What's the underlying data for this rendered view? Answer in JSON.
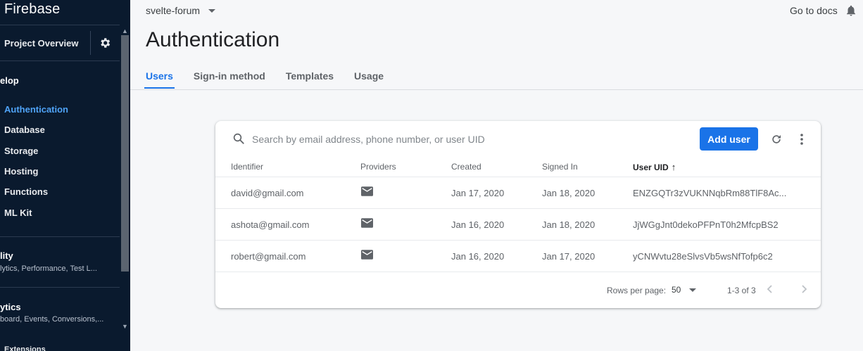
{
  "sidebar": {
    "brand": "Firebase",
    "overview": "Project Overview",
    "develop": {
      "title": "elop",
      "items": [
        "Authentication",
        "Database",
        "Storage",
        "Hosting",
        "Functions",
        "ML Kit"
      ]
    },
    "quality": {
      "title": "lity",
      "subtitle": "lytics, Performance, Test L..."
    },
    "analytics": {
      "title": "ytics",
      "subtitle": "board, Events, Conversions,..."
    },
    "extensions": "Extensions"
  },
  "header": {
    "project": "svelte-forum",
    "docs": "Go to docs",
    "title": "Authentication"
  },
  "tabs": [
    "Users",
    "Sign-in method",
    "Templates",
    "Usage"
  ],
  "table": {
    "search_placeholder": "Search by email address, phone number, or user UID",
    "add_user": "Add user",
    "columns": [
      "Identifier",
      "Providers",
      "Created",
      "Signed In",
      "User UID"
    ],
    "sort_arrow": "↑",
    "rows": [
      {
        "identifier": "david@gmail.com",
        "created": "Jan 17, 2020",
        "signed_in": "Jan 18, 2020",
        "uid": "ENZGQTr3zVUKNNqbRm88TlF8Ac..."
      },
      {
        "identifier": "ashota@gmail.com",
        "created": "Jan 16, 2020",
        "signed_in": "Jan 18, 2020",
        "uid": "JjWGgJnt0dekoPFPnT0h2MfcpBS2"
      },
      {
        "identifier": "robert@gmail.com",
        "created": "Jan 16, 2020",
        "signed_in": "Jan 17, 2020",
        "uid": "yCNWvtu28eSlvsVb5wsNfTofp6c2"
      }
    ],
    "rows_per_page_label": "Rows per page:",
    "rows_per_page": "50",
    "range": "1-3 of 3"
  },
  "icons": [
    "gear-icon",
    "bell-icon",
    "search-icon",
    "refresh-icon",
    "more-vert-icon",
    "mail-icon",
    "chevron-left-icon",
    "chevron-right-icon"
  ],
  "colors": {
    "sidebar_bg": "#0a1a2e",
    "accent": "#1a73e8",
    "active_nav": "#4fa3f7"
  }
}
